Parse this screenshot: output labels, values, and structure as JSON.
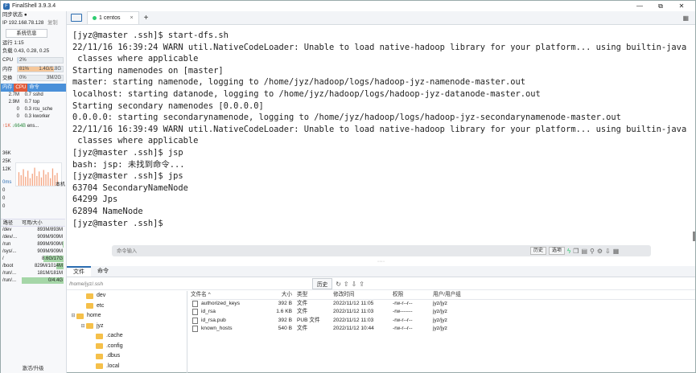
{
  "window": {
    "title": "FinalShell 3.9.3.4",
    "controls": [
      "—",
      "⧉",
      "✕"
    ]
  },
  "sidebar": {
    "sync_status": "同步状态 ●",
    "ip_label": "IP 192.168.78.128",
    "copy_label": "复制",
    "sysinfo_button": "系统信息",
    "uptime": "运行 1:15",
    "load": "负载 0.43, 0.28, 0.25",
    "cpu": {
      "label": "CPU",
      "percent": "2%",
      "fraction": 0.02
    },
    "mem": {
      "label": "内存",
      "percent": "81%",
      "value": "1.4G/1.8G",
      "fraction": 0.81
    },
    "swap": {
      "label": "交换",
      "percent": "0%",
      "value": "3M/2G",
      "fraction": 0.0
    },
    "proc_tabs": [
      "内存",
      "CPU",
      "命令"
    ],
    "processes": [
      {
        "mem": "2.7M",
        "cpu": "0.7",
        "cmd": "sshd"
      },
      {
        "mem": "2.9M",
        "cpu": "0.7",
        "cmd": "top"
      },
      {
        "mem": "0",
        "cpu": "0.3",
        "cmd": "rcu_sche"
      },
      {
        "mem": "0",
        "cpu": "0.3",
        "cmd": "kworker"
      }
    ],
    "net": {
      "up": "↑1K",
      "down": "↓664B",
      "iface": "ens...",
      "scale": [
        "36K",
        "25K",
        "12K"
      ]
    },
    "latency": {
      "label": "0ms",
      "host": "本机",
      "values": [
        "0",
        "0",
        "0"
      ]
    },
    "disk_head": {
      "path": "路径",
      "avail": "可用/大小"
    },
    "disks": [
      {
        "path": "/dev",
        "value": "893M/893M",
        "fill": 0.0
      },
      {
        "path": "/dev/...",
        "value": "909M/909M",
        "fill": 0.0
      },
      {
        "path": "/run",
        "value": "899M/909M",
        "fill": 0.01
      },
      {
        "path": "/sys/...",
        "value": "909M/909M",
        "fill": 0.0
      },
      {
        "path": "/",
        "value": "8.6G/17G",
        "fill": 0.49
      },
      {
        "path": "/boot",
        "value": "829M/1014M",
        "fill": 0.18
      },
      {
        "path": "/run/...",
        "value": "181M/181M",
        "fill": 0.0
      },
      {
        "path": "/run/...",
        "value": "0/4.4G",
        "fill": 1.0
      }
    ],
    "upgrade": "激活/升级"
  },
  "tabs": {
    "session_label": "1 centos",
    "close": "×",
    "add": "+"
  },
  "terminal": {
    "lines": [
      "[jyz@master .ssh]$ start-dfs.sh",
      "22/11/16 16:39:24 WARN util.NativeCodeLoader: Unable to load native-hadoop library for your platform... using builtin-java",
      " classes where applicable",
      "Starting namenodes on [master]",
      "master: starting namenode, logging to /home/jyz/hadoop/logs/hadoop-jyz-namenode-master.out",
      "localhost: starting datanode, logging to /home/jyz/hadoop/logs/hadoop-jyz-datanode-master.out",
      "Starting secondary namenodes [0.0.0.0]",
      "0.0.0.0: starting secondarynamenode, logging to /home/jyz/hadoop/logs/hadoop-jyz-secondarynamenode-master.out",
      "22/11/16 16:39:49 WARN util.NativeCodeLoader: Unable to load native-hadoop library for your platform... using builtin-java",
      " classes where applicable",
      "[jyz@master .ssh]$ jsp",
      "bash: jsp: 未找到命令...",
      "[jyz@master .ssh]$ jps",
      "63704 SecondaryNameNode",
      "64299 Jps",
      "62894 NameNode",
      "[jyz@master .ssh]$"
    ]
  },
  "command_bar": {
    "placeholder": "命令输入",
    "history": "历史",
    "options": "选项"
  },
  "bottom": {
    "tabs": [
      "文件",
      "命令"
    ],
    "path": "/home/jyz/.ssh",
    "history_button": "历史",
    "tree": [
      {
        "label": "dev",
        "depth": 1,
        "toggle": ""
      },
      {
        "label": "etc",
        "depth": 1,
        "toggle": ""
      },
      {
        "label": "home",
        "depth": 0,
        "toggle": "⊟"
      },
      {
        "label": "jyz",
        "depth": 1,
        "toggle": "⊟"
      },
      {
        "label": ".cache",
        "depth": 2,
        "toggle": ""
      },
      {
        "label": ".config",
        "depth": 2,
        "toggle": ""
      },
      {
        "label": ".dbus",
        "depth": 2,
        "toggle": ""
      },
      {
        "label": ".local",
        "depth": 2,
        "toggle": ""
      }
    ],
    "file_columns": [
      "文件名 ^",
      "大小",
      "类型",
      "修改时间",
      "权限",
      "用户/用户组"
    ],
    "files": [
      {
        "name": "authorized_keys",
        "size": "392 B",
        "type": "文件",
        "mtime": "2022/11/12 11:05",
        "perm": "-rw-r--r--",
        "owner": "jyz/jyz"
      },
      {
        "name": "id_rsa",
        "size": "1.6 KB",
        "type": "文件",
        "mtime": "2022/11/12 11:03",
        "perm": "-rw-------",
        "owner": "jyz/jyz"
      },
      {
        "name": "id_rsa.pub",
        "size": "392 B",
        "type": "PUB 文件",
        "mtime": "2022/11/12 11:03",
        "perm": "-rw-r--r--",
        "owner": "jyz/jyz"
      },
      {
        "name": "known_hosts",
        "size": "540 B",
        "type": "文件",
        "mtime": "2022/11/12 10:44",
        "perm": "-rw-r--r--",
        "owner": "jyz/jyz"
      }
    ]
  },
  "colors": {
    "accent": "#2b6cb0",
    "cpu_bar": "#bcd9f5",
    "mem_bar": "#f5c79a",
    "disk_fill": "#a5d6a7",
    "proc_header": "#4a90d9",
    "proc_selected": "#e05a3a"
  }
}
